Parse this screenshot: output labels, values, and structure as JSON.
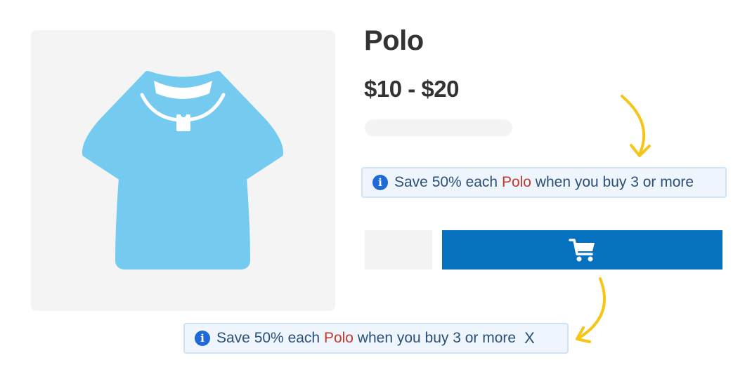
{
  "product": {
    "title": "Polo",
    "price": "$10 - $20",
    "image_icon": "polo-shirt-icon",
    "image_color": "#75caef"
  },
  "offer_banner": {
    "info_icon": "i",
    "text_prefix": "Save 50% each ",
    "highlight": "Polo",
    "text_suffix": " when you buy 3 or more",
    "close_label": "X"
  },
  "cart_button": {
    "icon": "cart-icon",
    "color": "#0671bf"
  },
  "colors": {
    "arrow": "#f5c518",
    "highlight": "#c0392b",
    "banner_text": "#2c4f78",
    "banner_background": "#eef5fc"
  }
}
